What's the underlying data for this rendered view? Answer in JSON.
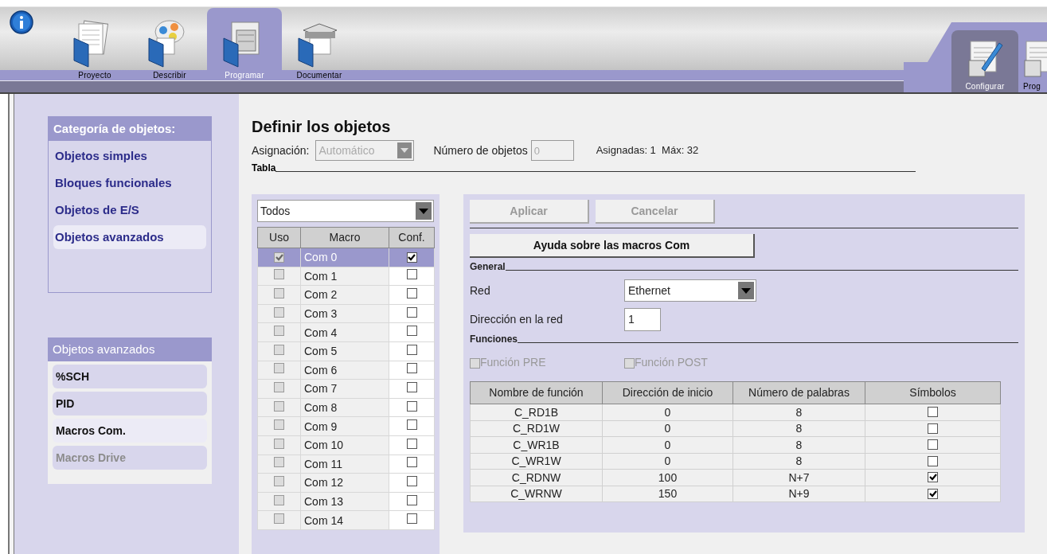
{
  "top_tabs": [
    {
      "label": "Proyecto",
      "selected": false,
      "kind": "pages"
    },
    {
      "label": "Describir",
      "selected": false,
      "kind": "diagram"
    },
    {
      "label": "Programar",
      "selected": true,
      "kind": "cabinet"
    },
    {
      "label": "Documentar",
      "selected": false,
      "kind": "printer"
    }
  ],
  "right_tabs": [
    {
      "label": "Configurar",
      "selected": true
    },
    {
      "label": "Prog",
      "selected": false
    }
  ],
  "categories": {
    "title": "Categoría de objetos:",
    "items": [
      {
        "label": "Objetos simples",
        "selected": false
      },
      {
        "label": "Bloques funcionales",
        "selected": false
      },
      {
        "label": "Objetos de E/S",
        "selected": false
      },
      {
        "label": "Objetos avanzados",
        "selected": true
      }
    ]
  },
  "advanced": {
    "title": "Objetos avanzados",
    "items": [
      {
        "label": "%SCH",
        "selected": false,
        "disabled": false
      },
      {
        "label": "PID",
        "selected": false,
        "disabled": false
      },
      {
        "label": "Macros Com.",
        "selected": true,
        "disabled": false
      },
      {
        "label": "Macros Drive",
        "selected": false,
        "disabled": true
      }
    ]
  },
  "heading": "Definir los objetos",
  "assignment": {
    "label": "Asignación:",
    "value": "Automático",
    "disabled": true
  },
  "object_count": {
    "label": "Número de objetos",
    "value": "0",
    "disabled": true
  },
  "assigned": "Asignadas: 1  Máx: 32",
  "table_section": "Tabla",
  "filter": "Todos",
  "macro_table": {
    "columns": [
      "Uso",
      "Macro",
      "Conf."
    ],
    "rows": [
      {
        "used": true,
        "macro": "Com 0",
        "configured": true,
        "selected": true
      },
      {
        "used": false,
        "macro": "Com 1",
        "configured": false,
        "selected": false
      },
      {
        "used": false,
        "macro": "Com 2",
        "configured": false,
        "selected": false
      },
      {
        "used": false,
        "macro": "Com 3",
        "configured": false,
        "selected": false
      },
      {
        "used": false,
        "macro": "Com 4",
        "configured": false,
        "selected": false
      },
      {
        "used": false,
        "macro": "Com 5",
        "configured": false,
        "selected": false
      },
      {
        "used": false,
        "macro": "Com 6",
        "configured": false,
        "selected": false
      },
      {
        "used": false,
        "macro": "Com 7",
        "configured": false,
        "selected": false
      },
      {
        "used": false,
        "macro": "Com 8",
        "configured": false,
        "selected": false
      },
      {
        "used": false,
        "macro": "Com 9",
        "configured": false,
        "selected": false
      },
      {
        "used": false,
        "macro": "Com 10",
        "configured": false,
        "selected": false
      },
      {
        "used": false,
        "macro": "Com 11",
        "configured": false,
        "selected": false
      },
      {
        "used": false,
        "macro": "Com 12",
        "configured": false,
        "selected": false
      },
      {
        "used": false,
        "macro": "Com 13",
        "configured": false,
        "selected": false
      },
      {
        "used": false,
        "macro": "Com 14",
        "configured": false,
        "selected": false
      }
    ]
  },
  "buttons": [
    {
      "label": "Aplicar",
      "disabled": true
    },
    {
      "label": "Cancelar",
      "disabled": true
    }
  ],
  "help_button": "Ayuda sobre las macros Com",
  "general": {
    "title": "General",
    "network_label": "Red",
    "network_value": "Ethernet",
    "address_label": "Dirección en la red",
    "address_value": "1"
  },
  "functions": {
    "title": "Funciones",
    "options": [
      {
        "label": "Función PRE",
        "checked": false,
        "disabled": true
      },
      {
        "label": "Función POST",
        "checked": false,
        "disabled": true
      }
    ]
  },
  "function_table": {
    "columns": [
      "Nombre de función",
      "Dirección de inicio",
      "Número de palabras",
      "Símbolos"
    ],
    "rows": [
      {
        "name": "C_RD1B",
        "start": "0",
        "words": "8",
        "symbols": false
      },
      {
        "name": "C_RD1W",
        "start": "0",
        "words": "8",
        "symbols": false
      },
      {
        "name": "C_WR1B",
        "start": "0",
        "words": "8",
        "symbols": false
      },
      {
        "name": "C_WR1W",
        "start": "0",
        "words": "8",
        "symbols": false
      },
      {
        "name": "C_RDNW",
        "start": "100",
        "words": "N+7",
        "symbols": true
      },
      {
        "name": "C_WRNW",
        "start": "150",
        "words": "N+9",
        "symbols": true
      }
    ]
  }
}
